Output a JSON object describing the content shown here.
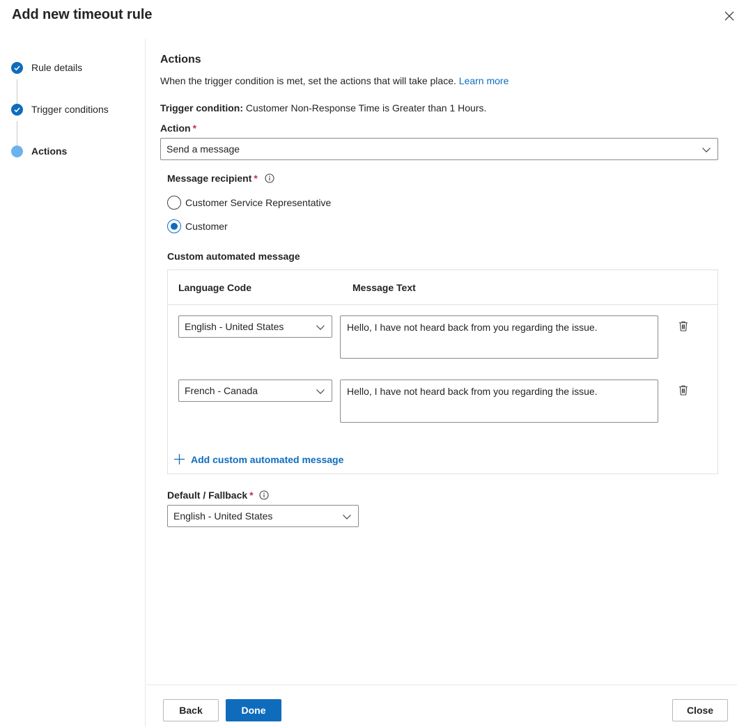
{
  "dialog": {
    "title": "Add new timeout rule",
    "close_icon": "close-icon"
  },
  "steps": [
    {
      "label": "Rule details",
      "state": "done"
    },
    {
      "label": "Trigger conditions",
      "state": "done"
    },
    {
      "label": "Actions",
      "state": "current"
    }
  ],
  "actions": {
    "heading": "Actions",
    "description": "When the trigger condition is met, set the actions that will take place.",
    "learn_more": "Learn more",
    "trigger_label": "Trigger condition:",
    "trigger_value": "Customer Non-Response Time is Greater than 1 Hours.",
    "action_label": "Action",
    "required_mark": "*",
    "action_value": "Send a message",
    "recipient_label": "Message recipient",
    "recipient_options": [
      {
        "label": "Customer Service Representative",
        "checked": false
      },
      {
        "label": "Customer",
        "checked": true
      }
    ],
    "custom_message_label": "Custom automated message",
    "table": {
      "col_language": "Language Code",
      "col_message": "Message Text",
      "rows": [
        {
          "language": "English - United States",
          "text": "Hello, I have not heard back from you regarding the issue."
        },
        {
          "language": "French - Canada",
          "text": "Hello, I have not heard back from you regarding the issue."
        }
      ],
      "add_label": "Add custom automated message"
    },
    "fallback_label": "Default / Fallback",
    "fallback_value": "English - United States"
  },
  "footer": {
    "back": "Back",
    "done": "Done",
    "close": "Close"
  },
  "colors": {
    "accent": "#0f6cbd",
    "current_step": "#6cb2ed",
    "required": "#c4314b"
  }
}
